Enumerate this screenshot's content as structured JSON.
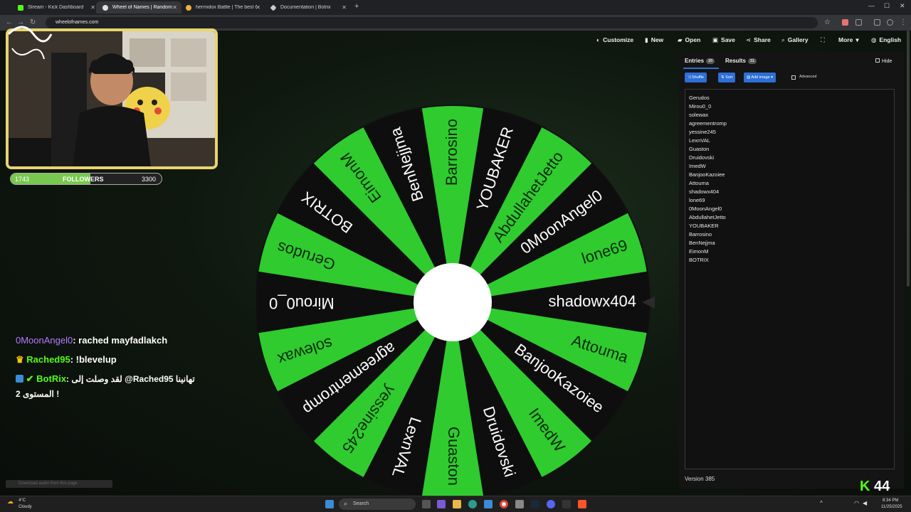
{
  "browser": {
    "tabs": [
      {
        "title": "Stream - Kick Dashboard",
        "color": "#53fc18"
      },
      {
        "title": "Wheel of Names | Random",
        "color": "#e0e0e0"
      },
      {
        "title": "hermidox Battle | The best Chu",
        "color": "#f0b040"
      },
      {
        "title": "Documentation | Botrix",
        "color": "#cccccc"
      }
    ],
    "url": "wheelofnames.com"
  },
  "topnav": {
    "customize": "Customize",
    "new": "New",
    "open": "Open",
    "save": "Save",
    "share": "Share",
    "gallery": "Gallery",
    "more": "More",
    "language": "English"
  },
  "panel": {
    "entries_tab": "Entries",
    "entries_count": "20",
    "results_tab": "Results",
    "results_count": "31",
    "hide_label": "Hide",
    "shuffle": "Shuffle",
    "sort": "Sort",
    "add_image": "Add image",
    "advanced": "Advanced",
    "entries": [
      "Gerudos",
      "Mirou0_0",
      "solewax",
      "agreementromp",
      "yessine245",
      "LexnVAL",
      "Guaston",
      "Druidovski",
      "ImedW",
      "BanjooKazoiee",
      "Attouma",
      "shadowx404",
      "lone69",
      "0MoonAngel0",
      "AbdullahetJetto",
      "YOUBAKER",
      "Barrosino",
      "BenNejjma",
      "EimonM",
      "BOTRIX"
    ],
    "version": "Version 385"
  },
  "wheel": {
    "selected": "shadowx404",
    "colors": {
      "green": "#2fcb2f",
      "black": "#0e0e0e",
      "label_on_green": "#0b2a0b",
      "label_on_black": "#ffffff"
    }
  },
  "overlay": {
    "followers_current": "1743",
    "followers_label": "FOLLOWERS",
    "followers_goal": "3300",
    "followers_progress": 0.53,
    "chat": [
      {
        "user": "0MoonAngel0",
        "text": ": rached mayfadlakch",
        "color": "#b57cff"
      },
      {
        "user": "Rached95",
        "text": ": !blevelup",
        "color": "#53fc18"
      },
      {
        "user": "BotRix",
        "text": ": لقد وصلت إلى @Rached95 تهانينا",
        "color": "#53fc18",
        "text2": "المستوى 2 !"
      }
    ],
    "download_hint": "Download audio from this page",
    "kick_count": "44"
  },
  "taskbar": {
    "search": "Search",
    "weather_temp": "4°C",
    "weather_desc": "Cloudy",
    "time": "8:34 PM",
    "date": "11/25/2025"
  }
}
